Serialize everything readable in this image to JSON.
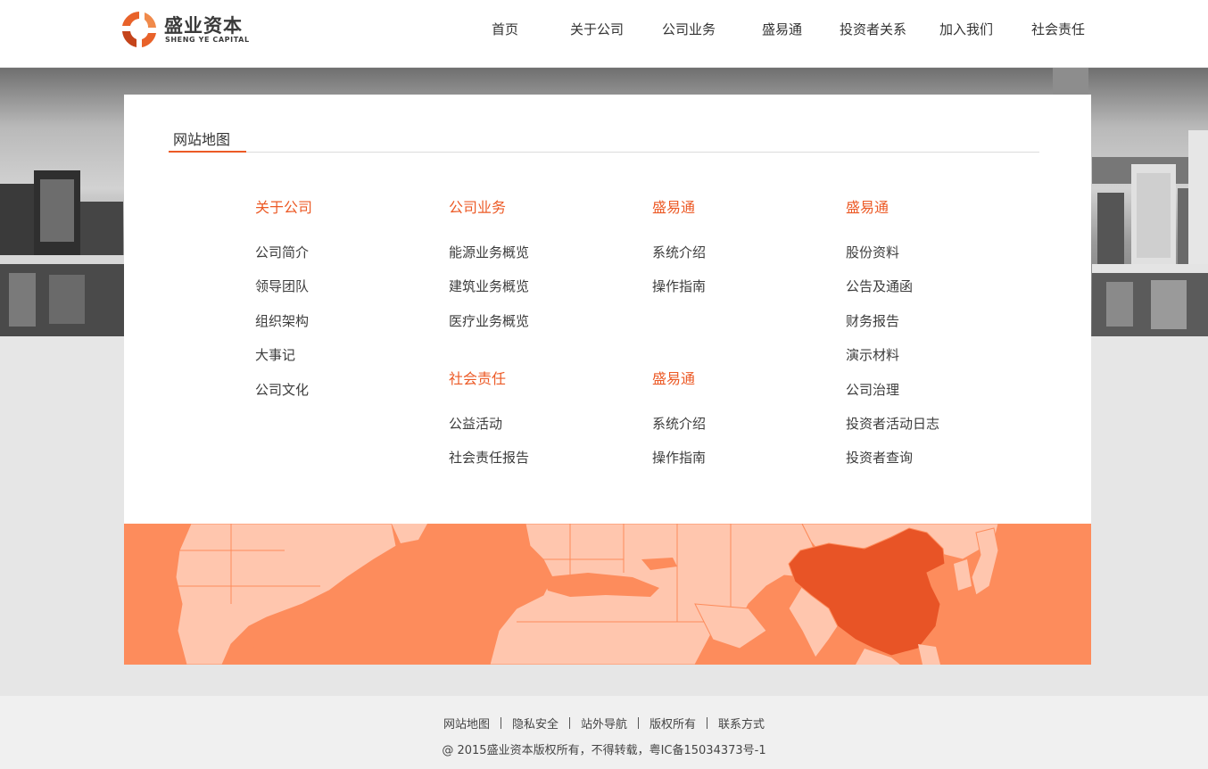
{
  "brand": {
    "name_cn": "盛业资本",
    "name_en": "SHENG YE CAPITAL"
  },
  "nav": {
    "items": [
      {
        "label": "首页"
      },
      {
        "label": "关于公司"
      },
      {
        "label": "公司业务"
      },
      {
        "label": "盛易通"
      },
      {
        "label": "投资者关系"
      },
      {
        "label": "加入我们"
      },
      {
        "label": "社会责任"
      }
    ]
  },
  "sitemap": {
    "title": "网站地图",
    "columns": [
      {
        "groups": [
          {
            "heading": "关于公司",
            "links": [
              "公司简介",
              "领导团队",
              "组织架构",
              "大事记",
              "公司文化"
            ]
          }
        ]
      },
      {
        "groups": [
          {
            "heading": "公司业务",
            "links": [
              "能源业务概览",
              "建筑业务概览",
              "医疗业务概览"
            ]
          },
          {
            "heading": "社会责任",
            "links": [
              "公益活动",
              "社会责任报告"
            ]
          }
        ]
      },
      {
        "groups": [
          {
            "heading": "盛易通",
            "links": [
              "系统介绍",
              "操作指南"
            ]
          },
          {
            "heading": "盛易通",
            "links": [
              "系统介绍",
              "操作指南"
            ]
          }
        ]
      },
      {
        "groups": [
          {
            "heading": "盛易通",
            "links": [
              "股份资料",
              "公告及通函",
              "财务报告",
              "演示材料",
              "公司治理",
              "投资者活动日志",
              "投资者查询"
            ]
          }
        ]
      }
    ]
  },
  "footer": {
    "links": [
      "网站地图",
      "隐私安全",
      "站外导航",
      "版权所有",
      "联系方式"
    ],
    "copyright": "@ 2015盛业资本版权所有，不得转载，粤IC备15034373号-1"
  },
  "colors": {
    "accent": "#ec5a26",
    "map_ocean": "#fd8c5c",
    "map_land": "#ffc6ae",
    "map_highlight": "#e85426"
  },
  "icons": {
    "logo": "sheng-ye-logo-icon"
  }
}
